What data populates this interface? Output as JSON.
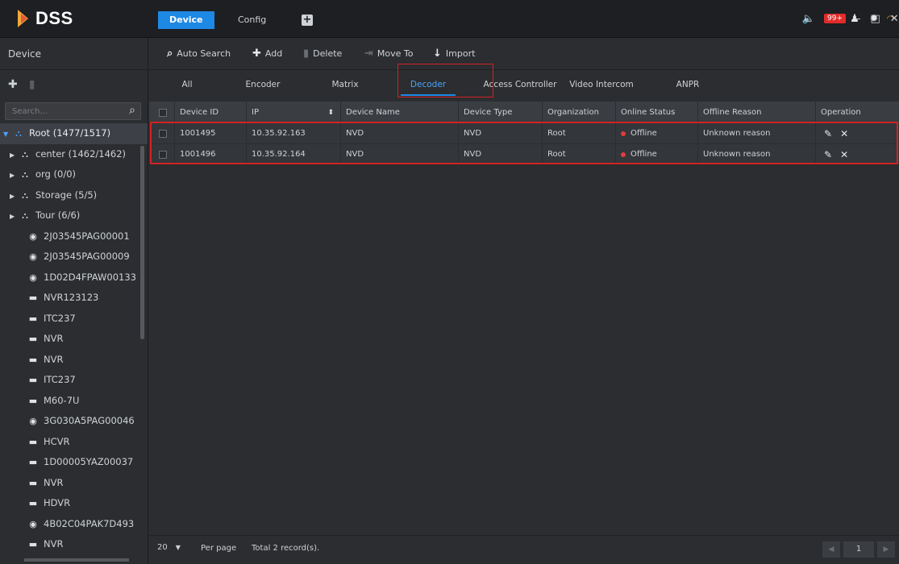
{
  "app": {
    "logo": "DSS"
  },
  "header": {
    "tabs": [
      {
        "label": "Device",
        "active": true
      },
      {
        "label": "Config",
        "active": false
      }
    ],
    "alarm_badge": "99+",
    "accent_color": "#1e88e5"
  },
  "left": {
    "title": "Device",
    "search_placeholder": "Search...",
    "tree": [
      {
        "label": "Root (1477/1517)",
        "icon": "org-icon",
        "level": 0,
        "expanded": true
      },
      {
        "label": "center (1462/1462)",
        "icon": "org-icon",
        "level": 1
      },
      {
        "label": "org (0/0)",
        "icon": "org-icon",
        "level": 1
      },
      {
        "label": "Storage (5/5)",
        "icon": "org-icon",
        "level": 1
      },
      {
        "label": "Tour (6/6)",
        "icon": "org-icon",
        "level": 1
      },
      {
        "label": "2J03545PAG00001",
        "icon": "camera-icon",
        "level": 2
      },
      {
        "label": "2J03545PAG00009",
        "icon": "camera-icon",
        "level": 2
      },
      {
        "label": "1D02D4FPAW00133",
        "icon": "camera-icon",
        "level": 2
      },
      {
        "label": "NVR123123",
        "icon": "recorder-icon",
        "level": 2
      },
      {
        "label": "ITC237",
        "icon": "recorder-icon",
        "level": 2
      },
      {
        "label": "NVR",
        "icon": "recorder-icon",
        "level": 2
      },
      {
        "label": "NVR",
        "icon": "recorder-icon",
        "level": 2
      },
      {
        "label": "ITC237",
        "icon": "recorder-icon",
        "level": 2
      },
      {
        "label": "M60-7U",
        "icon": "recorder-icon",
        "level": 2
      },
      {
        "label": "3G030A5PAG00046",
        "icon": "camera-icon",
        "level": 2
      },
      {
        "label": "HCVR",
        "icon": "recorder-icon",
        "level": 2
      },
      {
        "label": "1D00005YAZ00037",
        "icon": "recorder-icon",
        "level": 2
      },
      {
        "label": "NVR",
        "icon": "recorder-white-icon",
        "level": 2
      },
      {
        "label": "HDVR",
        "icon": "recorder-white-icon",
        "level": 2
      },
      {
        "label": "4B02C04PAK7D493",
        "icon": "camera-icon",
        "level": 2
      },
      {
        "label": "NVR",
        "icon": "recorder-icon",
        "level": 2
      }
    ]
  },
  "toolbar": {
    "auto_search": "Auto Search",
    "add": "Add",
    "delete": "Delete",
    "move_to": "Move To",
    "import": "Import"
  },
  "subtabs": [
    "All",
    "Encoder",
    "Matrix",
    "Decoder",
    "Access Controller",
    "Video Intercom",
    "ANPR"
  ],
  "active_subtab": "Decoder",
  "table": {
    "columns": [
      "Device ID",
      "IP",
      "Device Name",
      "Device Type",
      "Organization",
      "Online Status",
      "Offline Reason",
      "Operation"
    ],
    "rows": [
      {
        "device_id": "1001495",
        "ip": "10.35.92.163",
        "name": "NVD",
        "type": "NVD",
        "org": "Root",
        "status": "Offline",
        "reason": "Unknown reason"
      },
      {
        "device_id": "1001496",
        "ip": "10.35.92.164",
        "name": "NVD",
        "type": "NVD",
        "org": "Root",
        "status": "Offline",
        "reason": "Unknown reason"
      }
    ],
    "status_color": "#e23b3b"
  },
  "footer": {
    "per_page_value": "20",
    "per_page_label": "Per page",
    "total": "Total 2 record(s).",
    "page": "1"
  }
}
